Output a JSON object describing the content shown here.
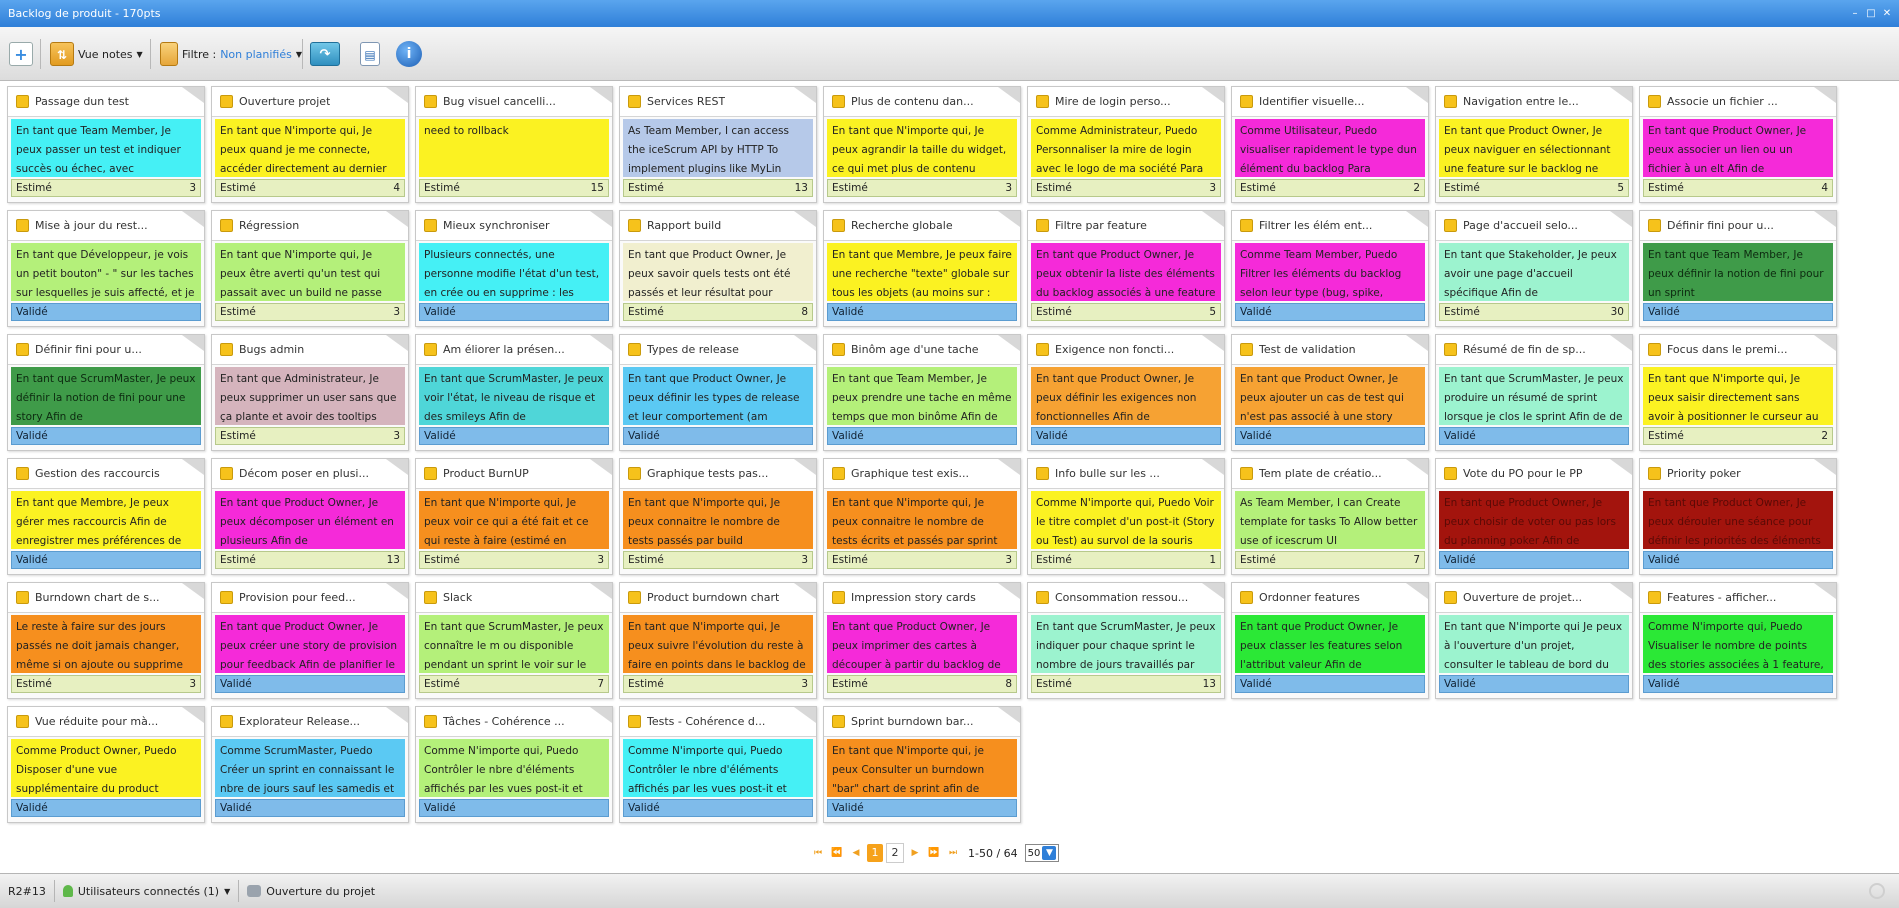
{
  "window": {
    "title": "Backlog de produit - 170pts",
    "minimize_icon": "minimize-icon",
    "restore_icon": "restore-icon",
    "close_icon": "close-icon"
  },
  "toolbar": {
    "view_label": "Vue notes",
    "filter_label": "Filtre :",
    "filter_value": "Non planifiés"
  },
  "cards": [
    {
      "title": "Passage dun test",
      "text": "En tant que Team Member, Je peux passer un test et indiquer succès ou échec, avec",
      "status": "Estimé",
      "points": "3",
      "color": "#45f0f5"
    },
    {
      "title": "Ouverture projet",
      "text": "En tant que N'importe qui, Je peux quand je me connecte, accéder directement au dernier projet",
      "status": "Estimé",
      "points": "4",
      "color": "#fbf222"
    },
    {
      "title": "Bug visuel cancelli...",
      "text": "need to rollback",
      "status": "Estimé",
      "points": "15",
      "color": "#fbf222"
    },
    {
      "title": "Services REST",
      "text": "As Team Member, I can access the iceScrum API by HTTP To implement plugins like MyLin",
      "status": "Estimé",
      "points": "13",
      "color": "#b6c9e9"
    },
    {
      "title": "Plus de contenu dan...",
      "text": "En tant que N'importe qui, Je peux agrandir la taille du widget, ce qui met plus de contenu dedans Afin de",
      "status": "Estimé",
      "points": "3",
      "color": "#fbf222"
    },
    {
      "title": "Mire de login perso...",
      "text": "Comme Administrateur, Puedo Personnaliser la mire de login avec le logo de ma société Para",
      "status": "Estimé",
      "points": "3",
      "color": "#fbf222"
    },
    {
      "title": "Identifier visuelle...",
      "text": "Comme Utilisateur, Puedo visualiser rapidement le type dun élément du backlog Para identifier le type bug,",
      "status": "Estimé",
      "points": "2",
      "color": "#f52ad9"
    },
    {
      "title": "Navigation entre le...",
      "text": "En tant que Product Owner, Je peux naviguer en sélectionnant une feature sur le backlog ne montrant",
      "status": "Estimé",
      "points": "5",
      "color": "#fbf222"
    },
    {
      "title": "Associe un fichier ...",
      "text": "En tant que Product Owner, Je peux associer un lien ou un fichier à un elt Afin de",
      "status": "Estimé",
      "points": "4",
      "color": "#f52ad9"
    },
    {
      "title": "Mise à jour du rest...",
      "text": "En tant que Développeur, je vois un petit bouton\" - \" sur les taches sur lesquelles je suis affecté, et je",
      "status": "Validé",
      "points": "",
      "color": "#b4f07a"
    },
    {
      "title": "Régression",
      "text": "En tant que N'importe qui, Je peux être averti qu'un test qui passait avec un build ne passe plus avec un",
      "status": "Estimé",
      "points": "3",
      "color": "#b4f07a"
    },
    {
      "title": "Mieux synchroniser",
      "text": "Plusieurs connectés, une personne modifie l'état d'un test, en crée ou en supprime : les autres ne le",
      "status": "Validé",
      "points": "",
      "color": "#45f0f5"
    },
    {
      "title": "Rapport build",
      "text": "En tant que Product Owner, Je peux savoir quels tests ont été passés et leur résultat pour chaque",
      "status": "Estimé",
      "points": "8",
      "color": "#f1efcf"
    },
    {
      "title": "Recherche globale",
      "text": "En tant que Membre, Je peux faire une recherche \"texte\" globale sur tous les objets (au moins sur :",
      "status": "Validé",
      "points": "",
      "color": "#fbf222"
    },
    {
      "title": "Filtre par feature",
      "text": "En tant que Product Owner, Je peux obtenir la liste des éléments du backlog associés à une feature",
      "status": "Estimé",
      "points": "5",
      "color": "#f52ad9"
    },
    {
      "title": "Filtrer les élém ent...",
      "text": "Comme Team Member, Puedo Filtrer les éléments du backlog selon leur type (bug, spike, feature, story)",
      "status": "Validé",
      "points": "",
      "color": "#f52ad9"
    },
    {
      "title": "Page d'accueil selo...",
      "text": "En tant que Stakeholder, Je peux avoir une page d'accueil spécifique Afin de",
      "status": "Estimé",
      "points": "30",
      "color": "#9cf3cf"
    },
    {
      "title": "Définir fini pour u...",
      "text": "En tant que Team Member, Je peux définir la notion de fini pour un sprint",
      "status": "Validé",
      "points": "",
      "color": "#3f9b49"
    },
    {
      "title": "Définir fini pour u...",
      "text": "En tant que ScrumMaster, Je peux définir la notion de fini pour une story Afin de",
      "status": "Validé",
      "points": "",
      "color": "#3f9b49"
    },
    {
      "title": "Bugs admin",
      "text": "En tant que Administrateur, Je peux supprimer un user sans que ça plante et avoir des tooltips corrects",
      "status": "Estimé",
      "points": "3",
      "color": "#d5b4bd"
    },
    {
      "title": "Am éliorer la présen...",
      "text": "En tant que ScrumMaster, Je peux voir l'état, le niveau de risque et des smileys Afin de",
      "status": "Validé",
      "points": "",
      "color": "#4fd6d8"
    },
    {
      "title": "Types de release",
      "text": "En tant que Product Owner, Je peux définir les types de release et leur comportement (am éliorer)",
      "status": "Validé",
      "points": "",
      "color": "#5bc9f3"
    },
    {
      "title": "Binôm age d'une tache",
      "text": "En tant que Team Member, Je peux prendre une tache en même temps que mon binôme Afin de",
      "status": "Validé",
      "points": "",
      "color": "#b4f07a"
    },
    {
      "title": "Exigence non foncti...",
      "text": "En tant que Product Owner, Je peux définir les exigences non fonctionnelles Afin de",
      "status": "Validé",
      "points": "",
      "color": "#f6a233"
    },
    {
      "title": "Test de validation",
      "text": "En tant que Product Owner, Je peux ajouter un cas de test qui n'est pas associé à une story mais qui",
      "status": "Validé",
      "points": "",
      "color": "#f6a233"
    },
    {
      "title": "Résumé de fin de sp...",
      "text": "En tant que ScrumMaster, Je peux produire un résumé de sprint lorsque je clos le sprint Afin de de",
      "status": "Validé",
      "points": "",
      "color": "#9cf3cf"
    },
    {
      "title": "Focus dans le premi...",
      "text": "En tant que N'importe qui, Je peux saisir directement sans avoir à positionner le curseur au bon",
      "status": "Estimé",
      "points": "2",
      "color": "#fbf222"
    },
    {
      "title": "Gestion des raccourcis",
      "text": "En tant que Membre, Je peux gérer mes raccourcis Afin de enregistrer mes préférences de navigation dans",
      "status": "Validé",
      "points": "",
      "color": "#fbf222"
    },
    {
      "title": "Décom poser en plusi...",
      "text": "En tant que Product Owner, Je peux décomposer un élément en plusieurs Afin de",
      "status": "Estimé",
      "points": "13",
      "color": "#f52ad9"
    },
    {
      "title": "Product BurnUP",
      "text": "En tant que N'importe qui, Je peux voir ce qui a été fait et ce qui reste à faire (estimé en points) mis à",
      "status": "Estimé",
      "points": "3",
      "color": "#f68f1e"
    },
    {
      "title": "Graphique tests pas...",
      "text": "En tant que N'importe qui, Je peux connaitre le nombre de tests passés par build",
      "status": "Estimé",
      "points": "3",
      "color": "#f68f1e"
    },
    {
      "title": "Graphique test exis...",
      "text": "En tant que N'importe qui, Je peux connaitre le nombre de tests écrits et passés par sprint",
      "status": "Estimé",
      "points": "3",
      "color": "#f68f1e"
    },
    {
      "title": "Info bulle sur les ...",
      "text": "Comme N'importe qui, Puedo Voir le titre complet d'un post-it (Story ou Test) au survol de la souris Para",
      "status": "Estimé",
      "points": "1",
      "color": "#fbf222"
    },
    {
      "title": "Tem plate de créatio...",
      "text": "As Team Member, I can Create template for tasks To Allow better use of icescrum UI",
      "status": "Estimé",
      "points": "7",
      "color": "#b4f07a"
    },
    {
      "title": "Vote du PO pour le PP",
      "text": "En tant que Product Owner, Je peux choisir de voter ou pas lors du planning poker Afin de",
      "status": "Validé",
      "points": "",
      "color": "#a3140d"
    },
    {
      "title": "Priority poker",
      "text": "En tant que Product Owner, Je peux dérouler une séance pour définir les priorités des éléments du",
      "status": "Validé",
      "points": "",
      "color": "#a3140d"
    },
    {
      "title": "Burndown chart de s...",
      "text": "Le reste à faire sur des jours passés ne doit jamais changer, même si on ajoute ou supprime des tâches.",
      "status": "Estimé",
      "points": "3",
      "color": "#f68f1e"
    },
    {
      "title": "Provision pour feed...",
      "text": "En tant que Product Owner, Je peux créer une story de provision pour feedback Afin de planifier le",
      "status": "Validé",
      "points": "",
      "color": "#f52ad9"
    },
    {
      "title": "Slack",
      "text": "En tant que ScrumMaster, Je peux connaître le m ou disponible pendant un sprint le voir sur le",
      "status": "Estimé",
      "points": "7",
      "color": "#b4f07a"
    },
    {
      "title": "Product burndown chart",
      "text": "En tant que N'importe qui, Je peux suivre l'évolution du reste à faire en points dans le backlog de produit,",
      "status": "Estimé",
      "points": "3",
      "color": "#f68f1e"
    },
    {
      "title": "Impression story cards",
      "text": "En tant que Product Owner, Je peux imprimer des cartes à découper à partir du backlog de",
      "status": "Estimé",
      "points": "8",
      "color": "#f52ad9"
    },
    {
      "title": "Consommation ressou...",
      "text": "En tant que ScrumMaster, Je peux indiquer pour chaque sprint le nombre de jours travaillés par",
      "status": "Estimé",
      "points": "13",
      "color": "#9cf3cf"
    },
    {
      "title": "Ordonner features",
      "text": "En tant que Product Owner, Je peux classer les features selon l'attribut valeur Afin de",
      "status": "Validé",
      "points": "",
      "color": "#2be836"
    },
    {
      "title": "Ouverture de projet...",
      "text": "En tant que N'importe qui Je peux à l'ouverture d'un projet, consulter le tableau de bord du projet qui",
      "status": "Validé",
      "points": "",
      "color": "#9cf3cf"
    },
    {
      "title": "Features - afficher...",
      "text": "Comme N'importe qui, Puedo Visualiser le nombre de points des stories associées à 1 feature, pour",
      "status": "Validé",
      "points": "",
      "color": "#2be836"
    },
    {
      "title": "Vue réduite pour mà...",
      "text": "Comme Product Owner, Puedo Disposer d'une vue supplémentaire du product backlog (vue réduite des",
      "status": "Validé",
      "points": "",
      "color": "#fbf222"
    },
    {
      "title": "Explorateur Release...",
      "text": "Comme ScrumMaster, Puedo Créer un sprint en connaissant le nbre de jours sauf les samedis et dimanches",
      "status": "Validé",
      "points": "",
      "color": "#5bc9f3"
    },
    {
      "title": "Tâches - Cohérence ...",
      "text": "Comme N'importe qui, Puedo Contrôler le nbre d'éléments affichés par les vues post-it et",
      "status": "Validé",
      "points": "",
      "color": "#b4f07a"
    },
    {
      "title": "Tests - Cohérence d...",
      "text": "Comme N'importe qui, Puedo Contrôler le nbre d'éléments affichés par les vues post-it et",
      "status": "Validé",
      "points": "",
      "color": "#45f0f5"
    },
    {
      "title": "Sprint burndown bar...",
      "text": "En tant que N'importe qui, je peux Consulter un burndown \"bar\" chart de sprint afin de Suivre l'évolution",
      "status": "Validé",
      "points": "",
      "color": "#f68f1e"
    }
  ],
  "pagination": {
    "current_page": "1",
    "next_page": "2",
    "range": "1-50 / 64",
    "page_size": "50"
  },
  "status_bar": {
    "release": "R2#13",
    "connected_users": "Utilisateurs connectés (1)",
    "project_opening": "Ouverture du projet"
  }
}
